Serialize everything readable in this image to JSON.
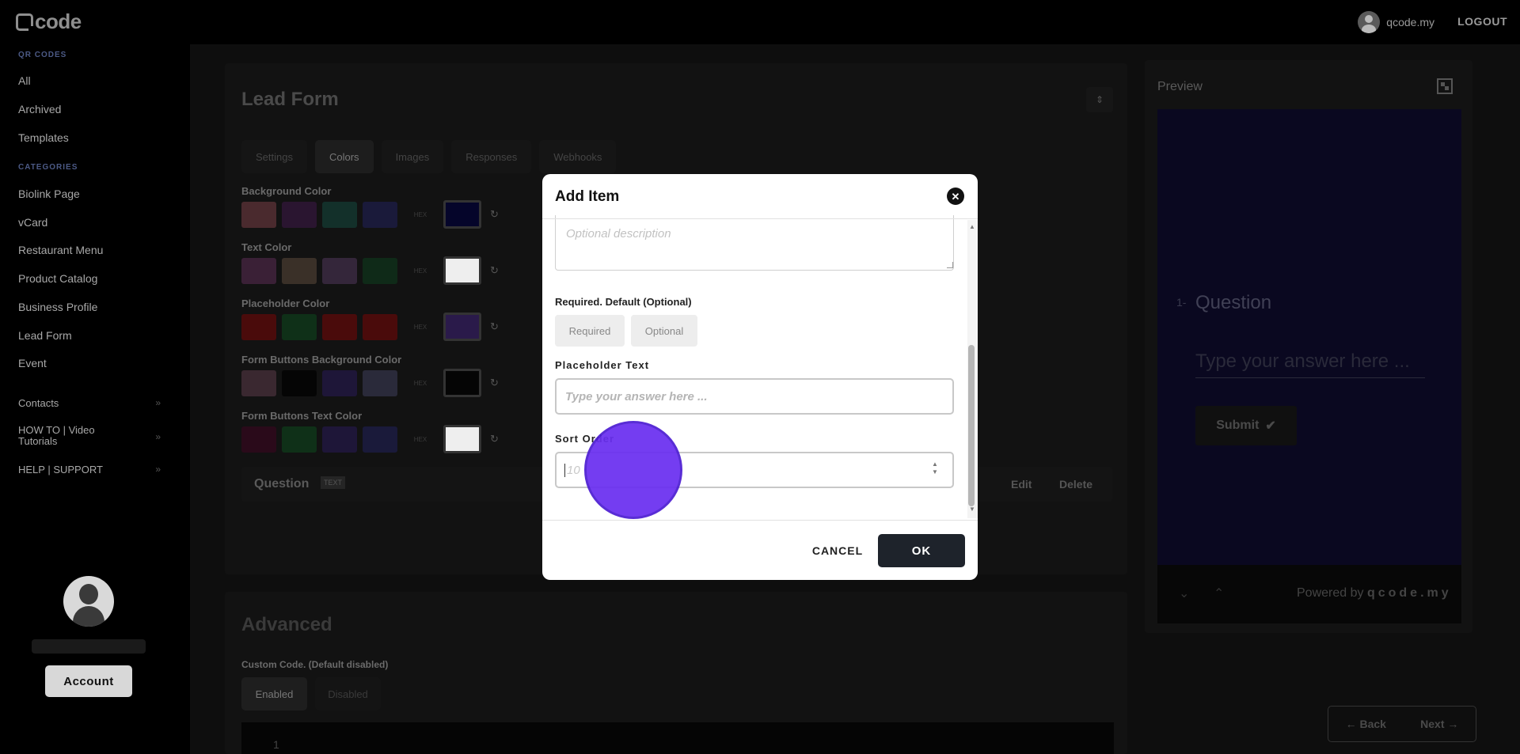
{
  "topbar": {
    "logo": "code",
    "username": "qcode.my",
    "logout": "LOGOUT"
  },
  "sidebar": {
    "qr_heading": "QR CODES",
    "qr_items": [
      {
        "label": "All"
      },
      {
        "label": "Archived"
      },
      {
        "label": "Templates"
      }
    ],
    "cat_heading": "CATEGORIES",
    "cat_items": [
      {
        "label": "Biolink Page"
      },
      {
        "label": "vCard"
      },
      {
        "label": "Restaurant Menu"
      },
      {
        "label": "Product Catalog"
      },
      {
        "label": "Business Profile"
      },
      {
        "label": "Lead Form"
      },
      {
        "label": "Event"
      }
    ],
    "expandables": [
      {
        "label": "Contacts"
      },
      {
        "label": "HOW TO | Video Tutorials"
      },
      {
        "label": "HELP | SUPPORT"
      }
    ],
    "account_label": "Account"
  },
  "editor": {
    "title": "Lead Form",
    "tabs": [
      {
        "label": "Settings"
      },
      {
        "label": "Colors"
      },
      {
        "label": "Images"
      },
      {
        "label": "Responses"
      },
      {
        "label": "Webhooks"
      }
    ],
    "active_tab": "Colors",
    "color_groups": [
      {
        "label": "Background Color",
        "swatches": [
          "#4a2a2e",
          "#2a1530",
          "#13302a",
          "#1a1a3a"
        ],
        "picker": "#05052a"
      },
      {
        "label": "Text Color",
        "swatches": [
          "#3a2036",
          "#3a3028",
          "#34263a",
          "#0f2a18"
        ],
        "picker": "#eeeeee"
      },
      {
        "label": "Placeholder Color",
        "swatches": [
          "#4a0b0b",
          "#0f3018",
          "#4a0b0b",
          "#4a0b0b"
        ],
        "picker": "#2a1a4a"
      },
      {
        "label": "Form Buttons Background Color",
        "swatches": [
          "#3a2830",
          "#050505",
          "#1e1638",
          "#2a2a3a"
        ],
        "picker": "#050505"
      },
      {
        "label": "Form Buttons Text Color",
        "swatches": [
          "#2a0a1a",
          "#0f3018",
          "#1e1638",
          "#1a1a3a"
        ],
        "picker": "#eeeeee"
      }
    ],
    "hex_label": "HEX",
    "question": {
      "title": "Question",
      "badge": "TEXT",
      "edit": "Edit",
      "delete": "Delete"
    },
    "advanced": {
      "title": "Advanced",
      "custom_code_label": "Custom Code. (Default disabled)",
      "enabled": "Enabled",
      "disabled": "Disabled",
      "code_line": "1"
    }
  },
  "preview": {
    "title": "Preview",
    "number": "1-",
    "question": "Question",
    "answer_placeholder": "Type your answer here ...",
    "submit": "Submit",
    "powered_prefix": "Powered by",
    "powered_brand": "qcode.my",
    "back": "Back",
    "next": "Next"
  },
  "modal": {
    "title": "Add Item",
    "description_placeholder": "Optional description",
    "required_label": "Required. Default (Optional)",
    "required_btn": "Required",
    "optional_btn": "Optional",
    "placeholder_label": "Placeholder Text",
    "placeholder_value": "Type your answer here ...",
    "sort_label": "Sort Order",
    "sort_placeholder": "10",
    "cancel": "CANCEL",
    "ok": "OK"
  },
  "colors": {
    "accent_cursor": "#6a2ff0",
    "ok_button": "#1e232b",
    "preview_bg": "#0a0820"
  }
}
